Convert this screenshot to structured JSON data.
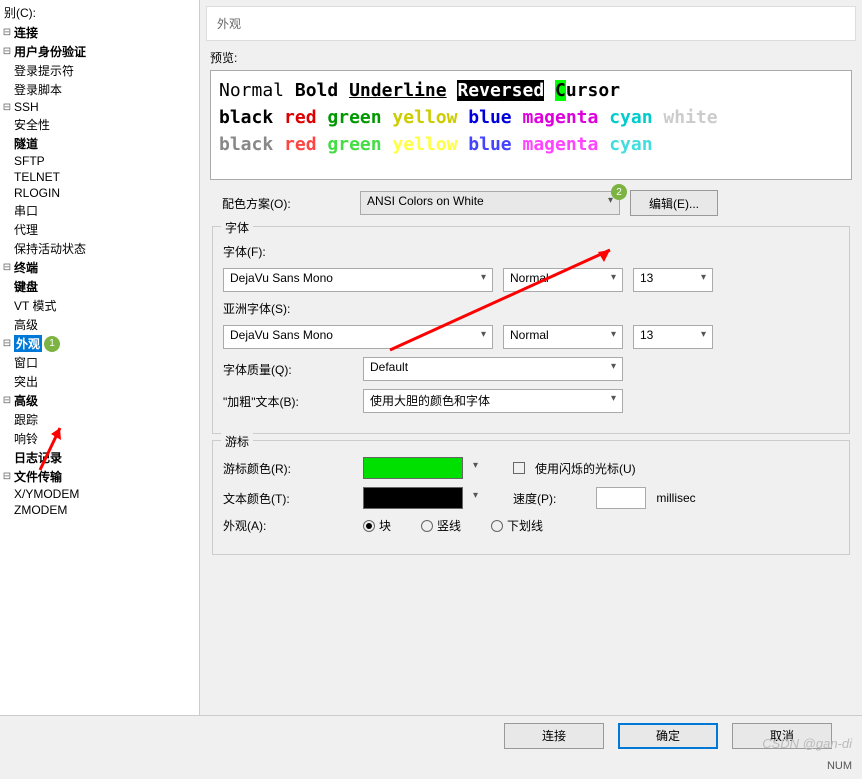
{
  "tree_label": "别(C):",
  "tree": {
    "connection": "连接",
    "user_auth": "用户身份验证",
    "login_prompt": "登录提示符",
    "login_script": "登录脚本",
    "ssh": "SSH",
    "security": "安全性",
    "tunnel": "隧道",
    "sftp": "SFTP",
    "telnet": "TELNET",
    "rlogin": "RLOGIN",
    "serial": "串口",
    "proxy": "代理",
    "keepalive": "保持活动状态",
    "terminal": "终端",
    "keyboard": "键盘",
    "vt_mode": "VT 模式",
    "advanced": "高级",
    "appearance": "外观",
    "window": "窗口",
    "highlight": "突出",
    "advanced2": "高级",
    "trace": "跟踪",
    "bell": "响铃",
    "logging": "日志记录",
    "file_transfer": "文件传输",
    "xymodem": "X/YMODEM",
    "zmodem": "ZMODEM"
  },
  "badges": {
    "one": "1",
    "two": "2"
  },
  "header": {
    "title": "外观"
  },
  "preview": {
    "label": "预览:",
    "normal": "Normal",
    "bold": "Bold",
    "underline": "Underline",
    "reversed": "Reversed",
    "cursor": "ursor",
    "cursor_c": "C",
    "black": "black",
    "red": "red",
    "green": "green",
    "yellow": "yellow",
    "blue": "blue",
    "magenta": "magenta",
    "cyan": "cyan",
    "white": "white"
  },
  "color_scheme": {
    "label": "配色方案(O):",
    "value": "ANSI Colors on White",
    "edit": "编辑(E)..."
  },
  "font": {
    "legend": "字体",
    "font_label": "字体(F):",
    "font_value": "DejaVu Sans Mono",
    "style_value": "Normal",
    "size_value": "13",
    "asian_label": "亚洲字体(S):",
    "asian_value": "DejaVu Sans Mono",
    "asian_style": "Normal",
    "asian_size": "13",
    "quality_label": "字体质量(Q):",
    "quality_value": "Default",
    "bold_label": "\"加粗\"文本(B):",
    "bold_value": "使用大胆的颜色和字体"
  },
  "cursor": {
    "legend": "游标",
    "color_label": "游标颜色(R):",
    "blink_label": "使用闪烁的光标(U)",
    "text_color_label": "文本颜色(T):",
    "speed_label": "速度(P):",
    "speed_unit": "millisec",
    "appearance_label": "外观(A):",
    "opt_block": "块",
    "opt_vline": "竖线",
    "opt_underline": "下划线"
  },
  "buttons": {
    "connect": "连接",
    "ok": "确定",
    "cancel": "取消"
  },
  "status": {
    "num": "NUM"
  },
  "watermark": "CSDN @gan-di"
}
